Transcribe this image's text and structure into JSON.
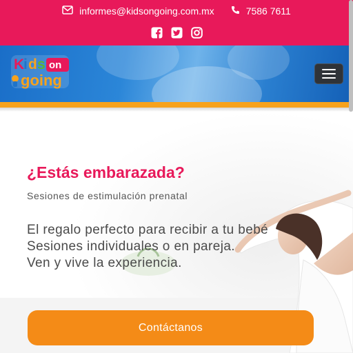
{
  "topbar": {
    "email": "informes@kidsongoing.com.mx",
    "phone": "7586 7611",
    "social": [
      "facebook-icon",
      "twitter-icon",
      "instagram-icon"
    ]
  },
  "header": {
    "logo_text_line1": "Kids on",
    "logo_text_line2": "going"
  },
  "hero": {
    "title": "¿Estás embarazada?",
    "subtitle": "Sesiones de estimulación prenatal",
    "body": [
      "El regalo perfecto para recibir a tu bebé",
      "Sesiones individuales o en pareja.",
      "Ven y vive la experiencia."
    ],
    "cta_label": "Contáctanos"
  },
  "colors": {
    "brand_pink": "#e8195a",
    "brand_orange": "#f48b17",
    "header_blue": "#2b86d8"
  }
}
